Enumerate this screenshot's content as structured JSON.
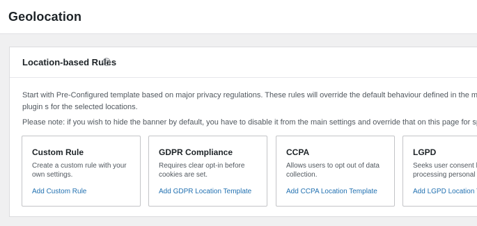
{
  "page": {
    "title": "Geolocation"
  },
  "panel": {
    "title": "Location-based Rules",
    "intro": "Start with Pre-Configured template based on major privacy regulations. These rules will override the default behaviour defined in the main plugin s for the selected locations.",
    "note": "Please note: if you wish to hide the banner by default, you have to disable it from the main settings and override that on this page for specific locat"
  },
  "cards": [
    {
      "title": "Custom Rule",
      "description": "Create a custom rule with your own settings.",
      "link": "Add Custom Rule"
    },
    {
      "title": "GDPR Compliance",
      "description": "Requires clear opt-in before cookies are set.",
      "link": "Add GDPR Location Template"
    },
    {
      "title": "CCPA",
      "description": "Allows users to opt out of data collection.",
      "link": "Add CCPA Location Template"
    },
    {
      "title": "LGPD",
      "description": "Seeks user consent be processing personal da",
      "link": "Add LGPD Location Te"
    }
  ],
  "colors": {
    "background": "#f0f0f1",
    "surface": "#ffffff",
    "border": "#dcdcde",
    "text": "#1d2327",
    "muted_text": "#50575e",
    "link": "#2271b1"
  },
  "icons": {
    "help": "help-circle-icon"
  }
}
